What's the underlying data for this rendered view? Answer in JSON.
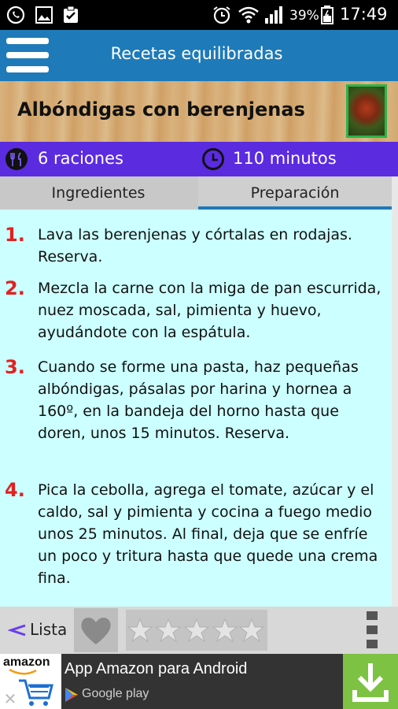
{
  "status_bar": {
    "icons": [
      "whatsapp-icon",
      "gallery-icon",
      "clipboard-check-icon",
      "alarm-icon",
      "wifi-icon",
      "signal-icon",
      "battery-icon"
    ],
    "battery": "39%",
    "time": "17:49"
  },
  "app_bar": {
    "title": "Recetas equilibradas",
    "menu_icon": "hamburger-menu-icon"
  },
  "recipe": {
    "title": "Albóndigas con berenjenas",
    "servings": "6 raciones",
    "time": "110 minutos"
  },
  "tabs": [
    {
      "label": "Ingredientes",
      "active": false
    },
    {
      "label": "Preparación",
      "active": true
    }
  ],
  "steps": [
    {
      "number": "1.",
      "text": "Lava las berenjenas y córtalas en rodajas. Reserva."
    },
    {
      "number": "2.",
      "text": "Mezcla la carne con la miga de pan escurrida, nuez moscada, sal, pimienta y huevo, ayudándote con la espátula."
    },
    {
      "number": "3.",
      "text": "Cuando se forme una pasta, haz pequeñas albóndigas, pásalas por harina y hornea a 160º, en la bandeja del horno hasta que doren, unos 15 minutos. Reserva."
    },
    {
      "number": "4.",
      "text": "Pica la cebolla, agrega el tomate, azúcar y el  caldo, sal y pimienta y cocina a fuego medio unos 25 minutos. Al final, deja que se enfríe un poco y tritura hasta que quede una crema fina."
    }
  ],
  "bottom_bar": {
    "list_label": "Lista",
    "rating": 0,
    "rating_max": 5
  },
  "ad": {
    "brand": "amazon",
    "title": "App Amazon para Android",
    "subtitle": "Google play"
  },
  "colors": {
    "app_bar": "#1e7ab8",
    "info_bar": "#5b2be0",
    "step_number": "#e32020",
    "content_bg": "#ccffff",
    "ad_download": "#7dc243"
  }
}
